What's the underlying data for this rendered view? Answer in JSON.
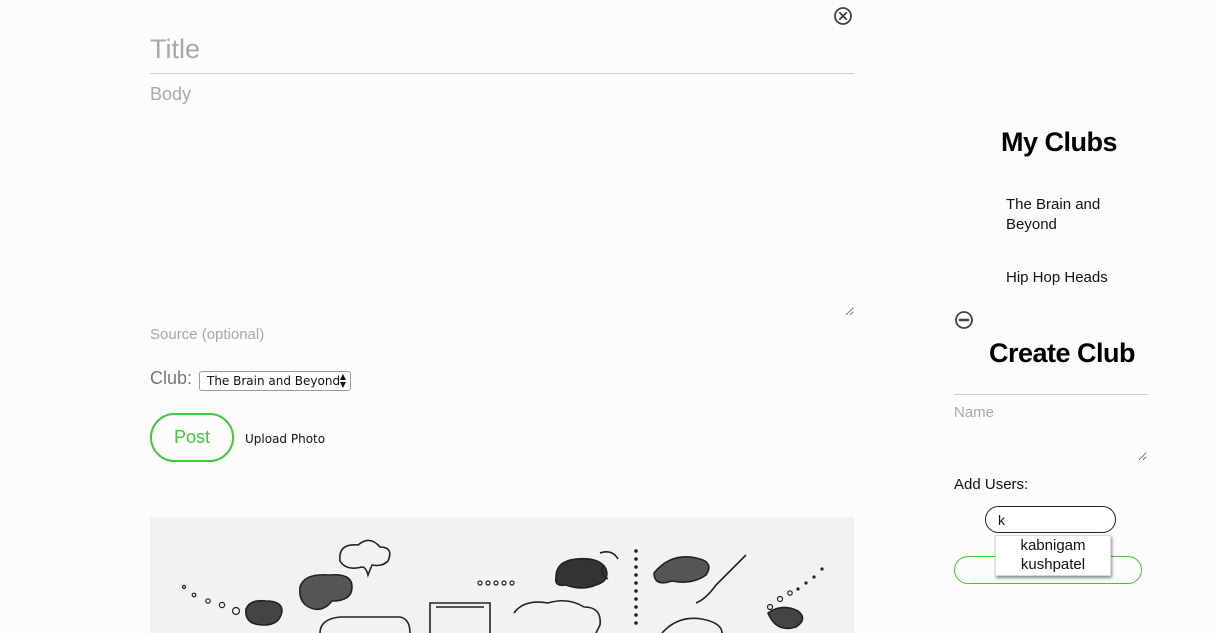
{
  "post_form": {
    "title_placeholder": "Title",
    "title_value": "",
    "body_placeholder": "Body",
    "body_value": "",
    "source_placeholder": "Source (optional)",
    "source_value": "",
    "club_label": "Club:",
    "club_selected": "The Brain and Beyond",
    "post_button": "Post",
    "upload_photo": "Upload Photo"
  },
  "sidebar": {
    "my_clubs_heading": "My Clubs",
    "clubs": [
      {
        "label": "The Brain and Beyond"
      },
      {
        "label": "Hip Hop Heads"
      }
    ],
    "create_club_heading": "Create Club",
    "name_placeholder": "Name",
    "name_value": "",
    "add_users_label": "Add Users:",
    "user_search_value": "k",
    "suggestions": [
      "kabnigam",
      "kushpatel"
    ]
  },
  "icons": {
    "close": "close-circle-icon",
    "minus": "minus-circle-icon",
    "select_arrows": "updown-arrows-icon"
  },
  "colors": {
    "accent_green": "#3cc83c",
    "placeholder": "#a8a8a8",
    "background": "#fdfcfb"
  }
}
